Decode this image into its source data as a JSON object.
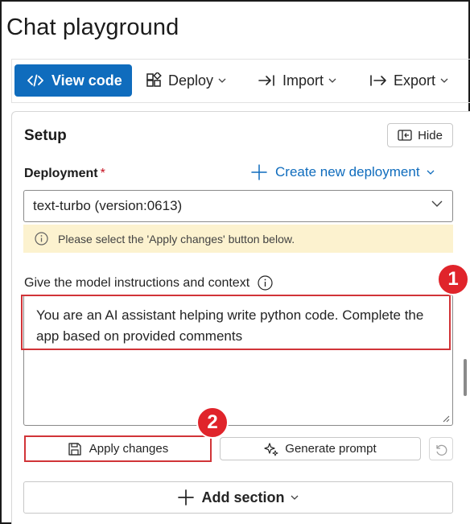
{
  "page": {
    "title": "Chat playground"
  },
  "toolbar": {
    "view_code": "View code",
    "deploy": "Deploy",
    "import": "Import",
    "export": "Export"
  },
  "setup": {
    "title": "Setup",
    "hide": "Hide",
    "deployment_label": "Deployment",
    "required_mark": "*",
    "create_link": "Create new deployment",
    "deployment_value": "text-turbo (version:0613)",
    "warning": "Please select the 'Apply changes' button below.",
    "instructions_label": "Give the model instructions and context",
    "instructions_value": "You are an AI assistant helping write python code. Complete the app based on provided comments",
    "apply_changes": "Apply changes",
    "generate_prompt": "Generate prompt",
    "add_section": "Add section"
  },
  "annotations": {
    "badge1": "1",
    "badge2": "2"
  },
  "colors": {
    "accent": "#0f6cbd",
    "highlight": "#d13438",
    "badge": "#e0242b",
    "warning_bg": "#fcf2cf"
  }
}
